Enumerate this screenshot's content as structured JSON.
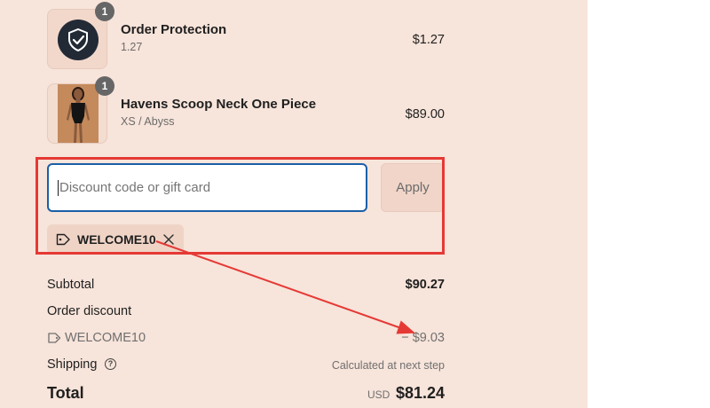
{
  "line_items": [
    {
      "name": "Order Protection",
      "variant": "1.27",
      "price": "$1.27",
      "quantity": "1",
      "icon": "shield-check-icon"
    },
    {
      "name": "Havens Scoop Neck One Piece",
      "variant": "XS / Abyss",
      "price": "$89.00",
      "quantity": "1",
      "icon": "product-photo"
    }
  ],
  "discount": {
    "placeholder": "Discount code or gift card",
    "value": "",
    "apply_label": "Apply",
    "applied_code": "WELCOME10"
  },
  "summary": {
    "subtotal_label": "Subtotal",
    "subtotal_value": "$90.27",
    "order_discount_label": "Order discount",
    "discount_code": "WELCOME10",
    "discount_value": "− $9.03",
    "shipping_label": "Shipping",
    "shipping_value": "Calculated at next step",
    "total_label": "Total",
    "total_currency": "USD",
    "total_value": "$81.24"
  },
  "colors": {
    "panel_background": "#f7e4da",
    "annotation_red": "#e53935",
    "input_focus_border": "#1b5fa8"
  }
}
